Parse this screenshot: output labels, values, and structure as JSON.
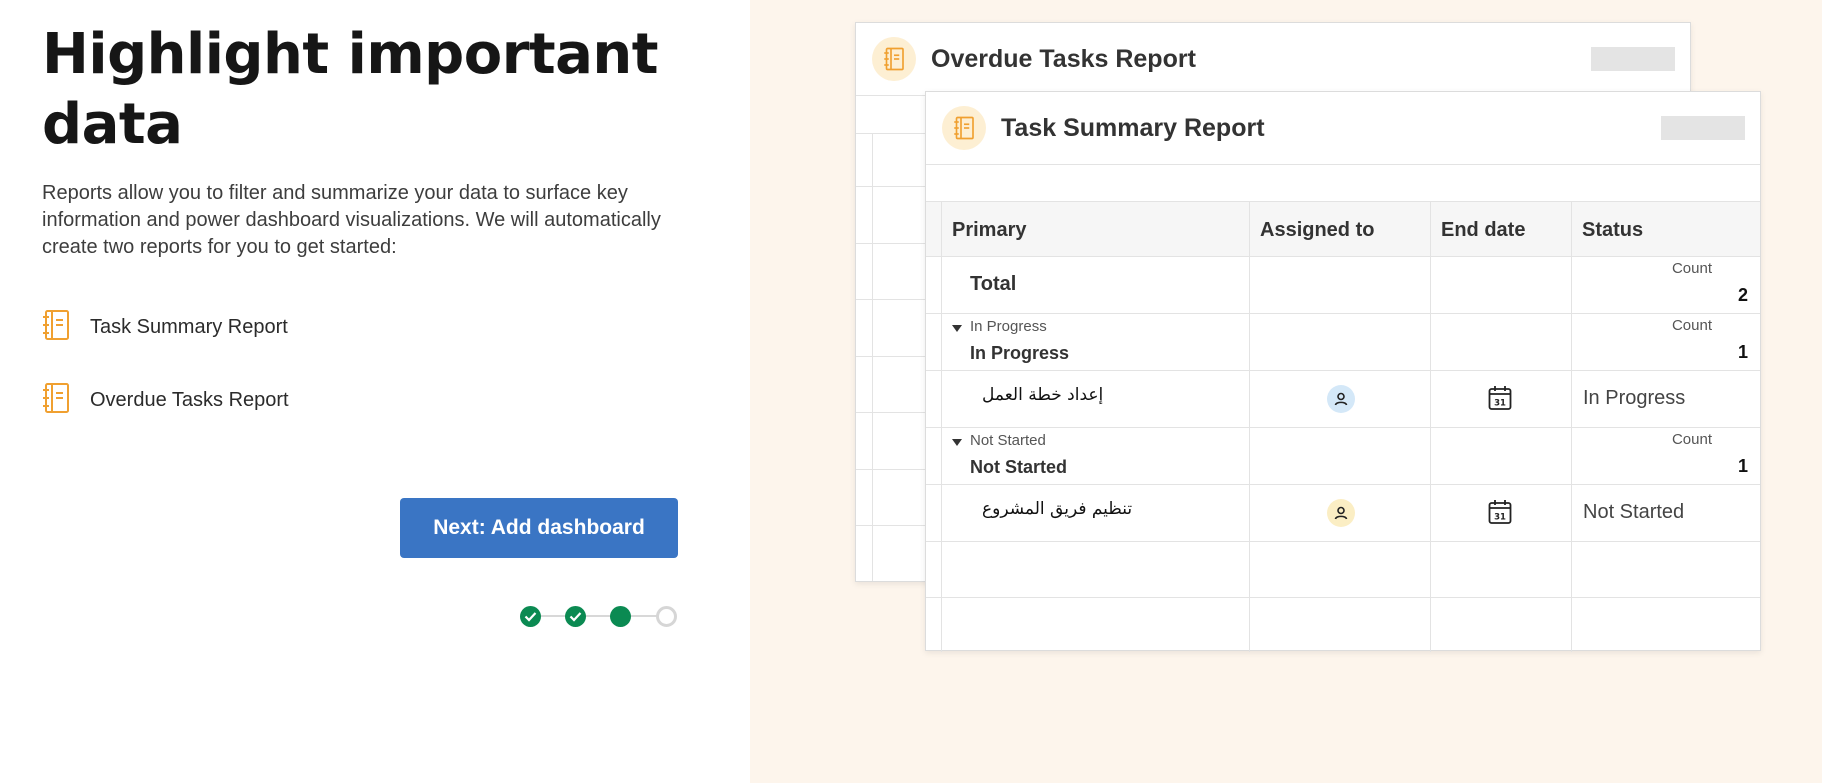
{
  "intro": {
    "title": "Highlight important data",
    "description": "Reports allow you to filter and summarize your data to surface key information and power dashboard visualizations. We will automatically create two reports for you to get started:",
    "reports": [
      {
        "label": "Task Summary Report",
        "icon": "report-book-icon"
      },
      {
        "label": "Overdue Tasks Report",
        "icon": "report-book-icon"
      }
    ],
    "next_button": "Next: Add dashboard",
    "stepper": {
      "total_steps": 4,
      "completed": 2,
      "current": 3
    }
  },
  "colors": {
    "accent_blue": "#3a75c4",
    "step_green": "#0b8a52",
    "report_orange": "#f0a030",
    "panel_bg": "#fdf5ec"
  },
  "overdue_card": {
    "title": "Overdue Tasks Report"
  },
  "summary_card": {
    "title": "Task Summary Report",
    "columns": [
      "Primary",
      "Assigned to",
      "End date",
      "Status"
    ],
    "total": {
      "label": "Total",
      "count_label": "Count",
      "count": "2"
    },
    "groups": [
      {
        "small_label": "In Progress",
        "bold_label": "In Progress",
        "count_label": "Count",
        "count": "1",
        "task": {
          "name": "إعداد خطة العمل",
          "status": "In Progress",
          "avatar_bg": "#d4e8f8"
        }
      },
      {
        "small_label": "Not Started",
        "bold_label": "Not Started",
        "count_label": "Count",
        "count": "1",
        "task": {
          "name": "تنظيم فريق المشروع",
          "status": "Not Started",
          "avatar_bg": "#fbeec4"
        }
      }
    ]
  }
}
